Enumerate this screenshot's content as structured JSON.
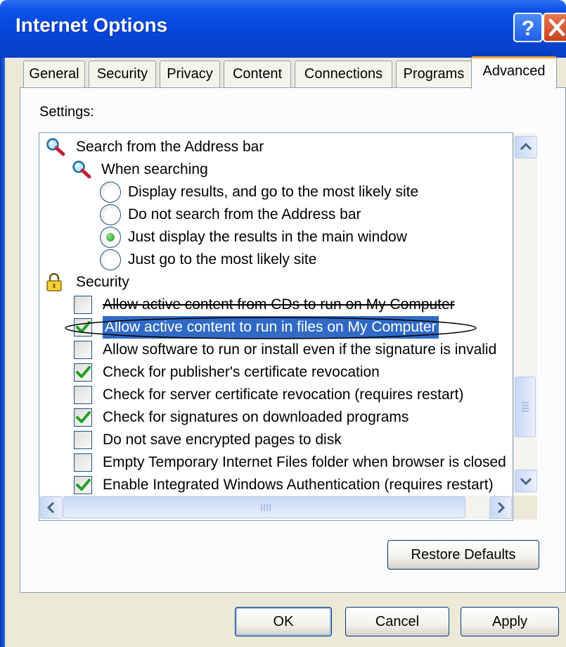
{
  "window": {
    "title": "Internet Options"
  },
  "tabs": [
    {
      "label": "General"
    },
    {
      "label": "Security"
    },
    {
      "label": "Privacy"
    },
    {
      "label": "Content"
    },
    {
      "label": "Connections"
    },
    {
      "label": "Programs"
    },
    {
      "label": "Advanced"
    }
  ],
  "active_tab": "Advanced",
  "settings_label": "Settings:",
  "settings": [
    {
      "kind": "group",
      "icon": "magnifier-icon",
      "label": "Search from the Address bar"
    },
    {
      "kind": "subgroup",
      "icon": "magnifier-icon",
      "label": "When searching"
    },
    {
      "kind": "radio",
      "checked": false,
      "label": "Display results, and go to the most likely site"
    },
    {
      "kind": "radio",
      "checked": false,
      "label": "Do not search from the Address bar"
    },
    {
      "kind": "radio",
      "checked": true,
      "label": "Just display the results in the main window"
    },
    {
      "kind": "radio",
      "checked": false,
      "label": "Just go to the most likely site"
    },
    {
      "kind": "group",
      "icon": "padlock-icon",
      "label": "Security"
    },
    {
      "kind": "checkbox",
      "checked": false,
      "label": "Allow active content from CDs to run on My Computer",
      "strikethrough": true
    },
    {
      "kind": "checkbox",
      "checked": true,
      "label": "Allow active content to run in files on My Computer",
      "selected": true
    },
    {
      "kind": "checkbox",
      "checked": false,
      "label": "Allow software to run or install even if the signature is invalid"
    },
    {
      "kind": "checkbox",
      "checked": true,
      "label": "Check for publisher's certificate revocation"
    },
    {
      "kind": "checkbox",
      "checked": false,
      "label": "Check for server certificate revocation (requires restart)"
    },
    {
      "kind": "checkbox",
      "checked": true,
      "label": "Check for signatures on downloaded programs"
    },
    {
      "kind": "checkbox",
      "checked": false,
      "label": "Do not save encrypted pages to disk"
    },
    {
      "kind": "checkbox",
      "checked": false,
      "label": "Empty Temporary Internet Files folder when browser is closed"
    },
    {
      "kind": "checkbox",
      "checked": true,
      "label": "Enable Integrated Windows Authentication (requires restart)"
    }
  ],
  "buttons": {
    "restore_defaults": "Restore Defaults",
    "ok": "OK",
    "cancel": "Cancel",
    "apply": "Apply"
  },
  "colors": {
    "titlebar": "#0546d8",
    "selection": "#316ac5",
    "active_tab_accent": "#f4a63b",
    "check_green": "#21a121"
  }
}
